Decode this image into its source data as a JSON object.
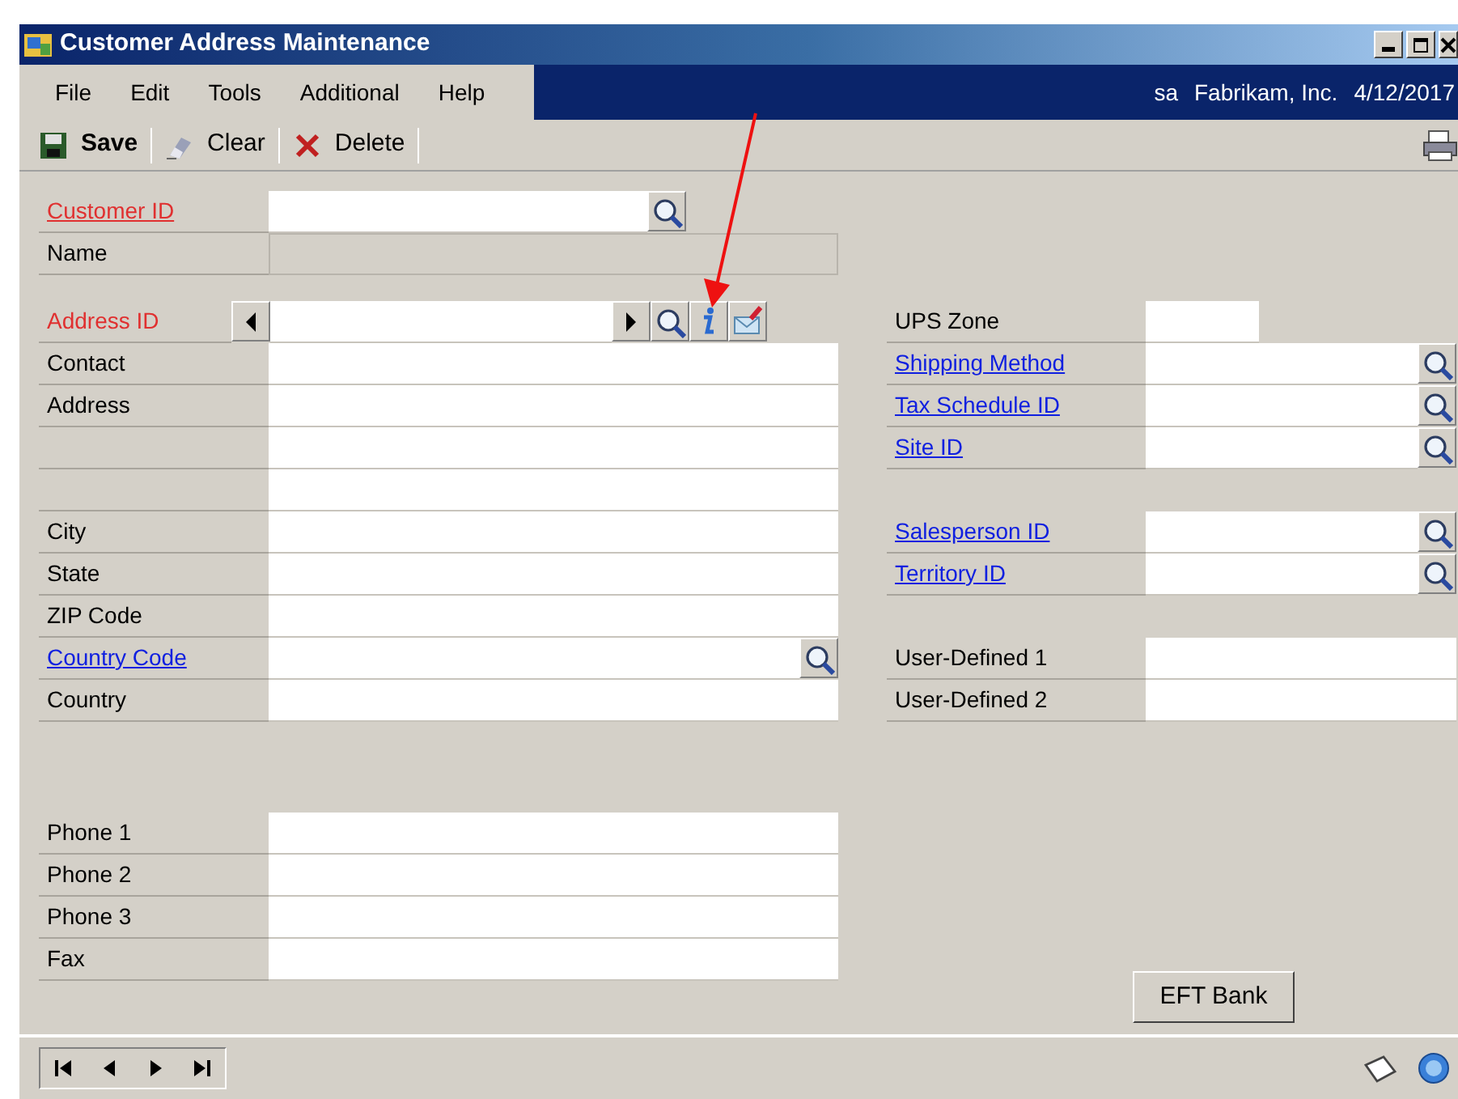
{
  "window": {
    "title": "Customer Address Maintenance"
  },
  "menu": [
    "File",
    "Edit",
    "Tools",
    "Additional",
    "Help"
  ],
  "session": {
    "user": "sa",
    "company": "Fabrikam, Inc.",
    "date": "4/12/2017"
  },
  "toolbar": [
    {
      "kind": "save",
      "label": "Save"
    },
    {
      "kind": "clear",
      "label": "Clear"
    },
    {
      "kind": "delete",
      "label": "Delete"
    }
  ],
  "left_groups": [
    [
      {
        "label": "Customer ID",
        "kind": "required-link",
        "short": true,
        "lookup": true
      },
      {
        "label": "Name",
        "kind": "plain",
        "disabled": true
      }
    ],
    [
      {
        "label": "Address ID",
        "kind": "required",
        "browse": true,
        "lookup": true,
        "info": true,
        "note": true
      },
      {
        "label": "Contact",
        "kind": "plain"
      },
      {
        "label": "Address",
        "kind": "plain"
      },
      {
        "kind": "plain"
      },
      {
        "kind": "plain"
      },
      {
        "label": "City",
        "kind": "plain"
      },
      {
        "label": "State",
        "kind": "plain"
      },
      {
        "label": "ZIP Code",
        "kind": "plain"
      },
      {
        "label": "Country Code",
        "kind": "link",
        "lookup": true
      },
      {
        "label": "Country",
        "kind": "plain"
      }
    ],
    [
      {
        "label": "Phone 1",
        "kind": "plain"
      },
      {
        "label": "Phone 2",
        "kind": "plain"
      },
      {
        "label": "Phone 3",
        "kind": "plain"
      },
      {
        "label": "Fax",
        "kind": "plain"
      }
    ]
  ],
  "right_groups": [
    [
      {
        "label": "UPS Zone",
        "kind": "plain",
        "short": true
      },
      {
        "label": "Shipping Method",
        "kind": "link",
        "lookup": true
      },
      {
        "label": "Tax Schedule ID",
        "kind": "link",
        "lookup": true
      },
      {
        "label": "Site ID",
        "kind": "link",
        "lookup": true
      }
    ],
    [
      {
        "label": "Salesperson ID",
        "kind": "link",
        "lookup": true
      },
      {
        "label": "Territory ID",
        "kind": "link",
        "lookup": true
      }
    ],
    [
      {
        "label": "User-Defined 1",
        "kind": "plain"
      },
      {
        "label": "User-Defined 2",
        "kind": "plain"
      }
    ]
  ],
  "eft_button": "EFT Bank"
}
